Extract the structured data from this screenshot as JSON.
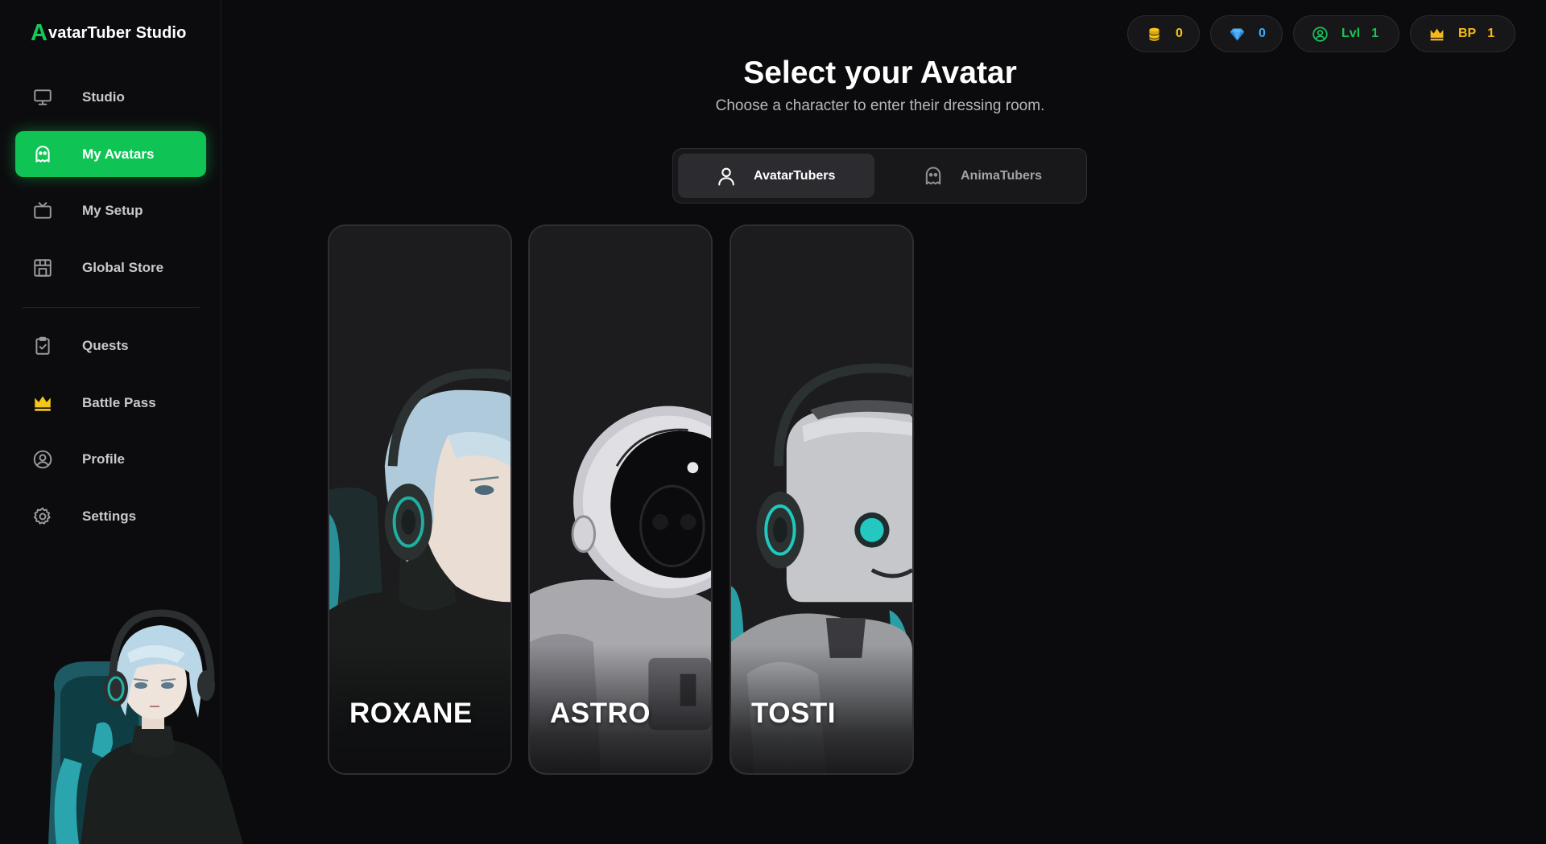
{
  "app": {
    "logo_initial": "A",
    "logo_rest": "vatarTuber Studio"
  },
  "sidebar": {
    "items": [
      {
        "label": "Studio",
        "icon": "monitor-icon"
      },
      {
        "label": "My Avatars",
        "icon": "ghost-icon",
        "active": true
      },
      {
        "label": "My Setup",
        "icon": "tv-icon"
      },
      {
        "label": "Global Store",
        "icon": "store-icon"
      },
      {
        "label": "Quests",
        "icon": "clipboard-check-icon"
      },
      {
        "label": "Battle Pass",
        "icon": "crown-icon"
      },
      {
        "label": "Profile",
        "icon": "user-circle-icon"
      },
      {
        "label": "Settings",
        "icon": "gear-icon"
      }
    ]
  },
  "stats": {
    "coins": {
      "value": "0",
      "icon": "coins-icon",
      "color": "#f5c518"
    },
    "gems": {
      "value": "0",
      "icon": "gem-icon",
      "color": "#3fa9f5"
    },
    "level": {
      "label": "Lvl",
      "value": "1",
      "icon": "user-circle-icon",
      "color": "#19c45a"
    },
    "battle_pass": {
      "label": "BP",
      "value": "1",
      "icon": "crown-icon",
      "color": "#f5b818"
    }
  },
  "header": {
    "title": "Select your Avatar",
    "subtitle": "Choose a character to enter their dressing room."
  },
  "tabs": [
    {
      "label": "AvatarTubers",
      "icon": "user-icon",
      "active": true
    },
    {
      "label": "AnimaTubers",
      "icon": "ghost-icon",
      "active": false
    }
  ],
  "avatars": [
    {
      "name": "ROXANE"
    },
    {
      "name": "ASTRO"
    },
    {
      "name": "TOSTI"
    }
  ],
  "colors": {
    "accent": "#0fc455",
    "background": "#0b0b0d",
    "card": "#1c1c1f"
  }
}
